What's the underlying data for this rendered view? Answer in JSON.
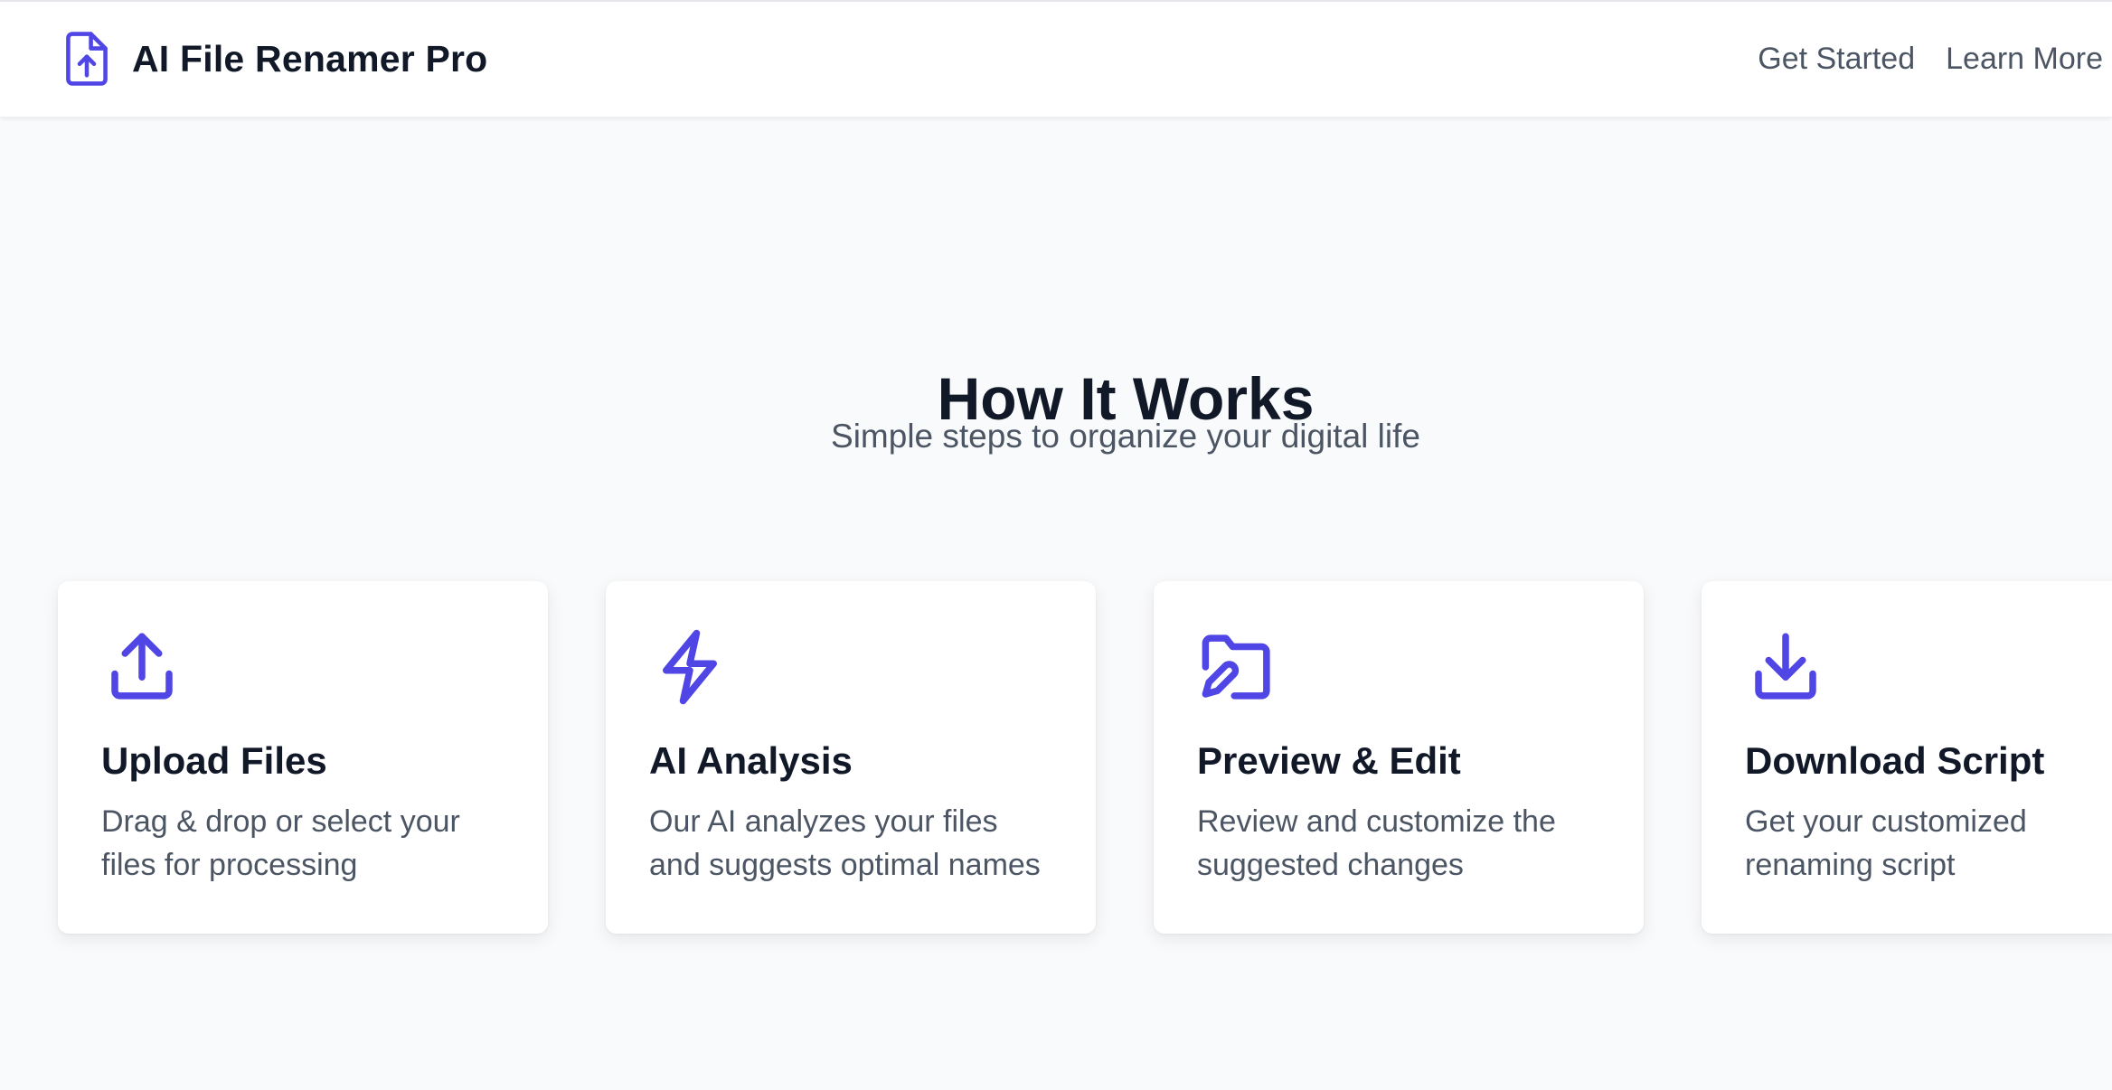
{
  "brand": {
    "name": "AI File Renamer Pro",
    "icon": "file-upload-icon",
    "accent": "#4f46e5"
  },
  "nav": {
    "links": [
      "Get Started",
      "Learn More"
    ]
  },
  "section": {
    "title": "How It Works",
    "subtitle": "Simple steps to organize your digital life"
  },
  "steps": [
    {
      "icon": "upload-icon",
      "title": "Upload Files",
      "description": "Drag & drop or select your files for processing"
    },
    {
      "icon": "lightning-bolt-icon",
      "title": "AI Analysis",
      "description": "Our AI analyzes your files and suggests optimal names"
    },
    {
      "icon": "folder-edit-icon",
      "title": "Preview & Edit",
      "description": "Review and customize the suggested changes"
    },
    {
      "icon": "download-icon",
      "title": "Download Script",
      "description": "Get your customized renaming script"
    }
  ],
  "colors": {
    "page_background": "#f9fafb",
    "card_background": "#ffffff",
    "heading": "#111827",
    "body_text": "#4b5563",
    "icon": "#4f46e5"
  }
}
